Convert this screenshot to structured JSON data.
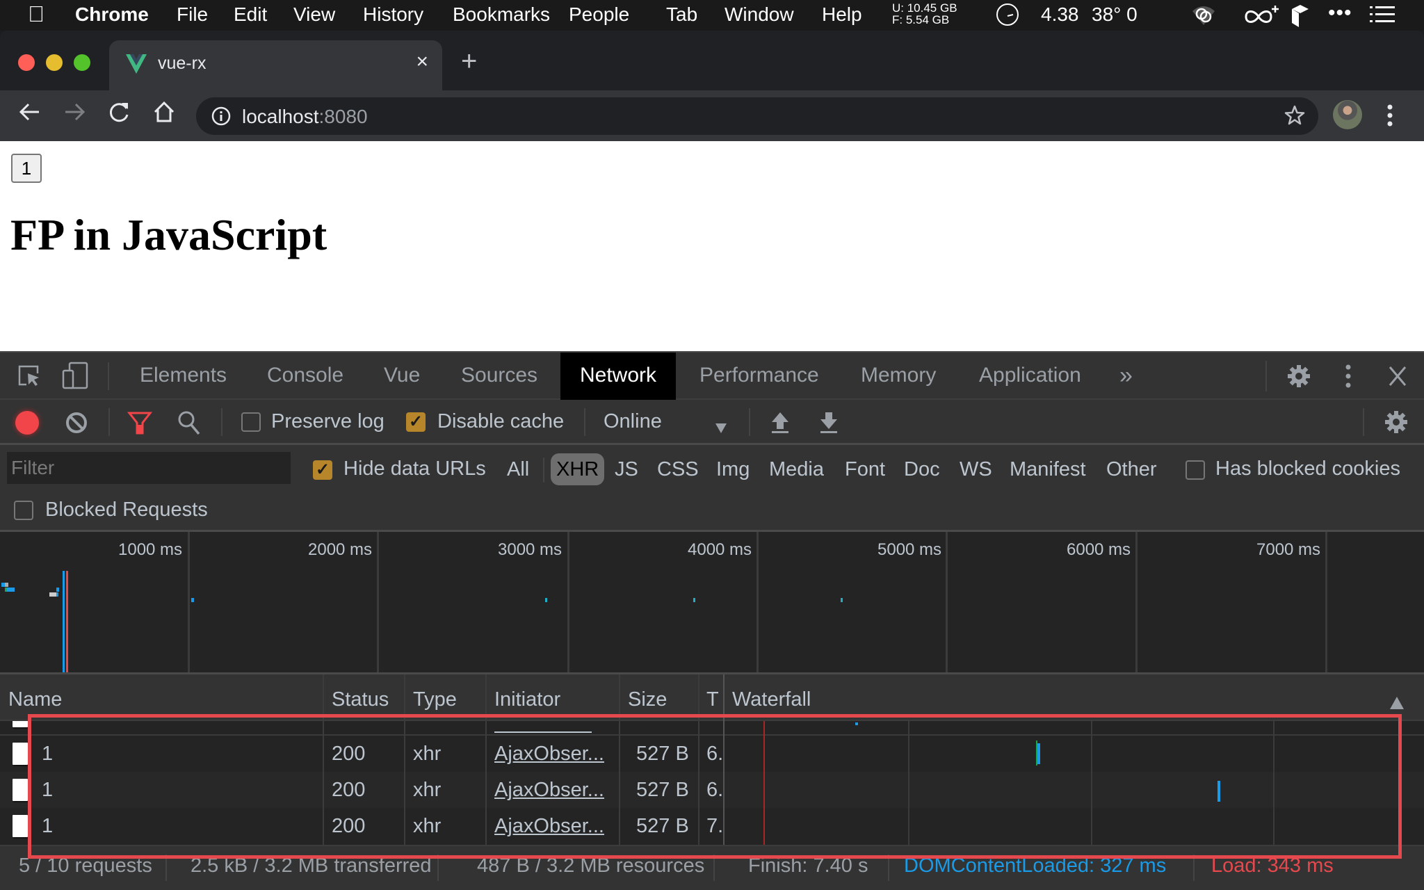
{
  "menubar": {
    "app": "Chrome",
    "items": [
      "File",
      "Edit",
      "View",
      "History",
      "Bookmarks",
      "People",
      "Tab",
      "Window",
      "Help"
    ],
    "memory_used": "U:  10.45 GB",
    "memory_free": "F:    5.54 GB",
    "load": "4.38",
    "temp": "38° 0",
    "icons": [
      "apple-icon",
      "clock-icon",
      "cloud-link-icon",
      "infinity-plus-icon",
      "box-icon",
      "more-icon",
      "list-icon"
    ]
  },
  "browser": {
    "tab_title": "vue-rx",
    "url_host": "localhost",
    "url_port": ":8080",
    "accent_colors": {
      "close": "#ff5f57",
      "minimize": "#febc2e",
      "maximize": "#28c840",
      "vue_green": "#41b883"
    }
  },
  "page": {
    "button_label": "1",
    "heading": "FP in JavaScript"
  },
  "devtools": {
    "tabs": [
      {
        "label": "Elements",
        "active": false
      },
      {
        "label": "Console",
        "active": false
      },
      {
        "label": "Vue",
        "active": false
      },
      {
        "label": "Sources",
        "active": false
      },
      {
        "label": "Network",
        "active": true
      },
      {
        "label": "Performance",
        "active": false
      },
      {
        "label": "Memory",
        "active": false
      },
      {
        "label": "Application",
        "active": false
      }
    ],
    "more_tabs": "»",
    "toolbar": {
      "preserve_log": "Preserve log",
      "preserve_log_checked": false,
      "disable_cache": "Disable cache",
      "disable_cache_checked": true,
      "throttling": "Online"
    },
    "filter": {
      "placeholder": "Filter",
      "value": "",
      "hide_data_urls": "Hide data URLs",
      "hide_data_urls_checked": true,
      "types": [
        "All",
        "XHR",
        "JS",
        "CSS",
        "Img",
        "Media",
        "Font",
        "Doc",
        "WS",
        "Manifest",
        "Other"
      ],
      "active_type": "XHR",
      "has_blocked_cookies": "Has blocked cookies",
      "has_blocked_cookies_checked": false,
      "blocked_requests": "Blocked Requests",
      "blocked_requests_checked": false
    },
    "overview": {
      "ticks": [
        "1000 ms",
        "2000 ms",
        "3000 ms",
        "4000 ms",
        "5000 ms",
        "6000 ms",
        "7000 ms"
      ],
      "dom_content_loaded_color": "#1a9be8",
      "load_color": "#e5484d"
    },
    "table": {
      "columns": [
        "Name",
        "Status",
        "Type",
        "Initiator",
        "Size",
        "T",
        "Waterfall"
      ],
      "rows": [
        {
          "name": "1",
          "status": "200",
          "type": "xhr",
          "initiator": "AjaxObser...",
          "size": "527 B",
          "time": "6."
        },
        {
          "name": "1",
          "status": "200",
          "type": "xhr",
          "initiator": "AjaxObser...",
          "size": "527 B",
          "time": "6."
        },
        {
          "name": "1",
          "status": "200",
          "type": "xhr",
          "initiator": "AjaxObser...",
          "size": "527 B",
          "time": "7."
        }
      ]
    },
    "status": {
      "requests": "5 / 10 requests",
      "transferred": "2.5 kB / 3.2 MB transferred",
      "resources": "487 B / 3.2 MB resources",
      "finish": "Finish: 7.40 s",
      "dom_content_loaded": "DOMContentLoaded: 327 ms",
      "load": "Load: 343 ms",
      "dcl_color": "#1a9be8",
      "load_color": "#e5484d"
    }
  }
}
